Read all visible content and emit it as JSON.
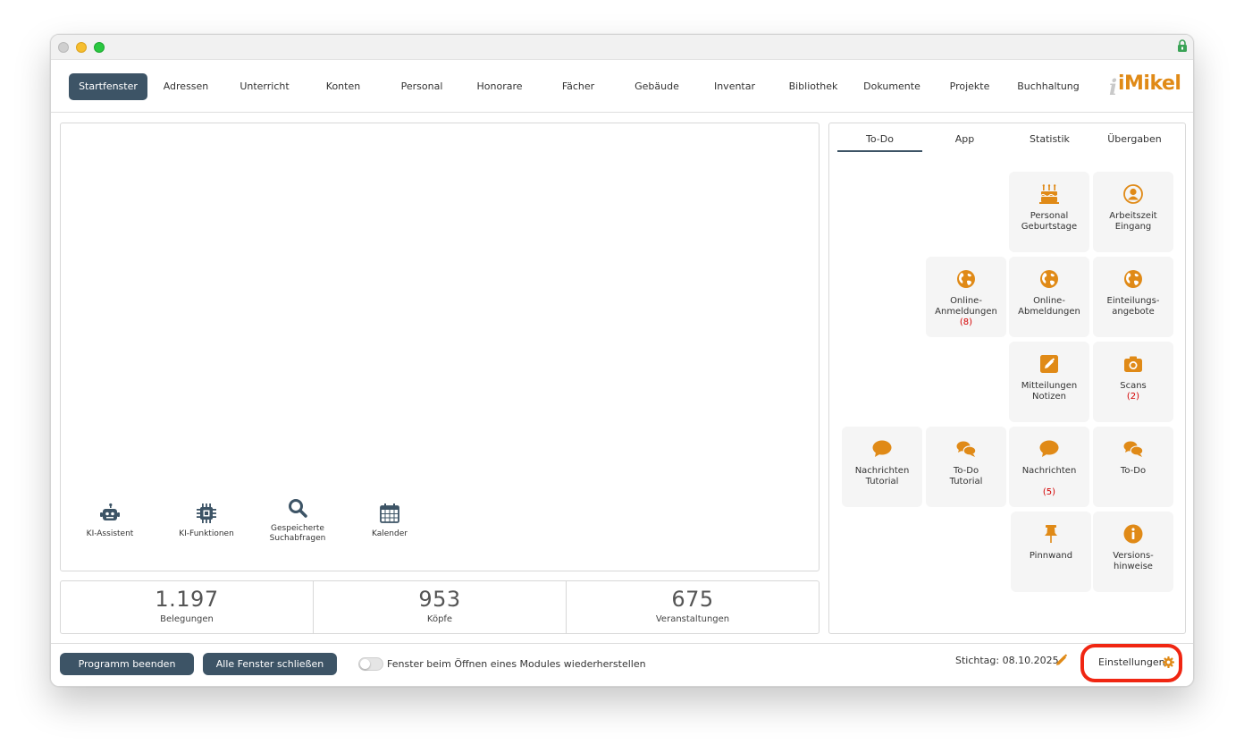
{
  "nav": {
    "items": [
      {
        "label": "Startfenster"
      },
      {
        "label": "Adressen"
      },
      {
        "label": "Unterricht"
      },
      {
        "label": "Konten"
      },
      {
        "label": "Personal"
      },
      {
        "label": "Honorare"
      },
      {
        "label": "Fächer"
      },
      {
        "label": "Gebäude"
      },
      {
        "label": "Inventar"
      },
      {
        "label": "Bibliothek"
      },
      {
        "label": "Dokumente"
      },
      {
        "label": "Projekte"
      },
      {
        "label": "Buchhaltung"
      }
    ],
    "logo": "iMikel"
  },
  "quick_actions": [
    {
      "label": "KI-Assistent",
      "icon": "robot-icon"
    },
    {
      "label": "KI-Funktionen",
      "icon": "chip-icon"
    },
    {
      "label_line1": "Gespeicherte",
      "label_line2": "Suchabfragen",
      "icon": "search-icon"
    },
    {
      "label": "Kalender",
      "icon": "calendar-icon"
    }
  ],
  "stats": [
    {
      "value": "1.197",
      "label": "Belegungen"
    },
    {
      "value": "953",
      "label": "Köpfe"
    },
    {
      "value": "675",
      "label": "Veranstaltungen"
    }
  ],
  "tabs": [
    {
      "label": "To-Do"
    },
    {
      "label": "App"
    },
    {
      "label": "Statistik"
    },
    {
      "label": "Übergaben"
    }
  ],
  "tiles": {
    "personal_geburtstage": {
      "line1": "Personal",
      "line2": "Geburtstage",
      "icon": "cake-icon"
    },
    "arbeitszeit_eingang": {
      "line1": "Arbeitszeit",
      "line2": "Eingang",
      "icon": "user-icon"
    },
    "online_anmeldungen": {
      "line1": "Online-",
      "line2": "Anmeldungen",
      "count": "(8)",
      "icon": "globe-icon"
    },
    "online_abmeldungen": {
      "line1": "Online-",
      "line2": "Abmeldungen",
      "icon": "globe-icon"
    },
    "einteilungsangebote": {
      "line1": "Einteilungs-",
      "line2": "angebote",
      "icon": "globe-icon"
    },
    "mitteilungen_notizen": {
      "line1": "Mitteilungen",
      "line2": "Notizen",
      "icon": "edit-icon"
    },
    "scans": {
      "line1": "Scans",
      "count": "(2)",
      "icon": "camera-icon"
    },
    "nachrichten_tutorial": {
      "line1": "Nachrichten",
      "line2": "Tutorial",
      "icon": "chat-bubble-icon"
    },
    "todo_tutorial": {
      "line1": "To-Do",
      "line2": "Tutorial",
      "icon": "chat-bubbles-icon"
    },
    "nachrichten": {
      "line1": "Nachrichten",
      "count": "(5)",
      "icon": "chat-bubble-icon"
    },
    "todo": {
      "line1": "To-Do",
      "icon": "chat-bubbles-icon"
    },
    "pinnwand": {
      "line1": "Pinnwand",
      "icon": "pin-icon"
    },
    "versionshinweise": {
      "line1": "Versions-",
      "line2": "hinweise",
      "icon": "info-icon"
    }
  },
  "bottom": {
    "quit_label": "Programm beenden",
    "close_all_label": "Alle Fenster schließen",
    "toggle_label": "Fenster beim Öffnen eines Modules wiederherstellen",
    "stichtag": "Stichtag: 08.10.2025",
    "settings_label": "Einstellungen"
  },
  "colors": {
    "accent": "#e08a17",
    "primary": "#3d5466",
    "count": "#d40000",
    "highlight": "#f02612"
  }
}
